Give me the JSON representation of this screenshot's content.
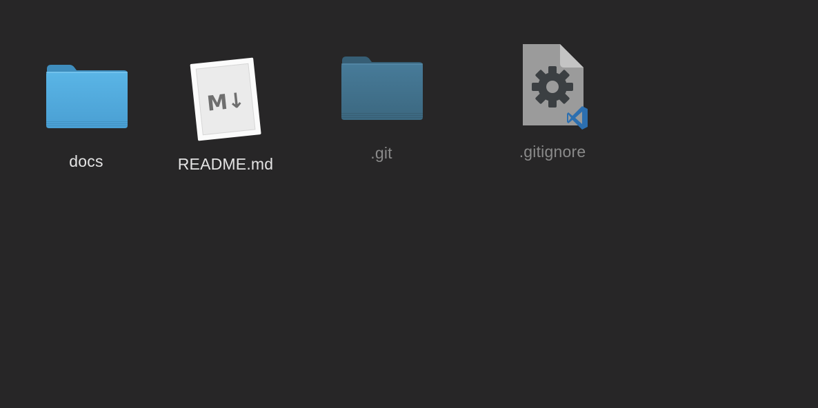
{
  "window": {
    "background": "#272627"
  },
  "files": [
    {
      "name": "docs",
      "kind": "folder",
      "icon": "folder-icon",
      "hidden": false,
      "color": "#4fa9dc"
    },
    {
      "name": "README.md",
      "kind": "markdown",
      "icon": "markdown-file-icon",
      "hidden": false,
      "badge_text": "M↓"
    },
    {
      "name": ".git",
      "kind": "folder",
      "icon": "folder-icon",
      "hidden": true,
      "color": "#3f6f8b"
    },
    {
      "name": ".gitignore",
      "kind": "config",
      "icon": "gear-document-icon",
      "hidden": true,
      "badge_icon": "vscode-icon"
    }
  ]
}
